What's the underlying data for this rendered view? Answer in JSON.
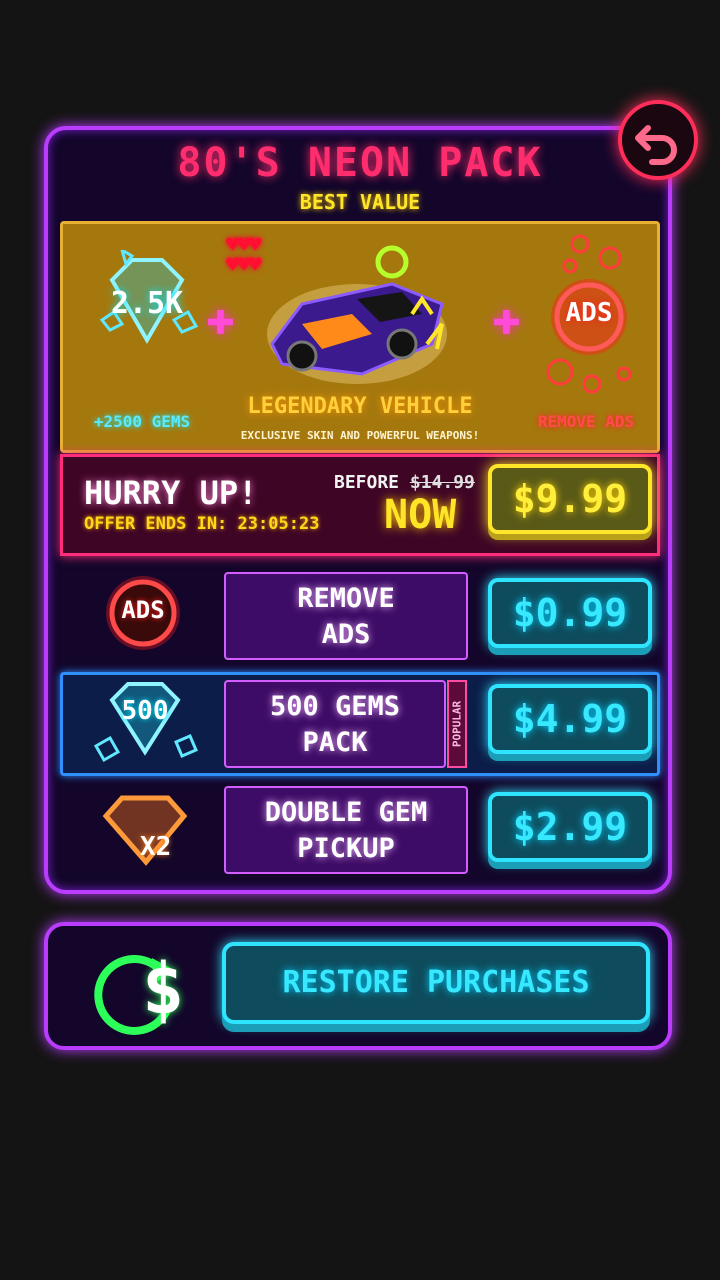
{
  "pack": {
    "title": "80'S NEON PACK",
    "subtitle": "BEST VALUE",
    "gem_icon_value": "2.5K",
    "gems_label": "+2500 GEMS",
    "vehicle_label": "LEGENDARY VEHICLE",
    "vehicle_desc": "EXCLUSIVE SKIN AND POWERFUL WEAPONS!",
    "ads_icon_text": "ADS",
    "remove_ads_label": "REMOVE ADS"
  },
  "offer": {
    "hurry": "HURRY UP!",
    "ends_label": "OFFER ENDS IN:",
    "timer": "23:05:23",
    "before_label": "BEFORE",
    "old_price": "$14.99",
    "now_label": "NOW",
    "price": "$9.99"
  },
  "items": [
    {
      "icon_text": "ADS",
      "line1": "REMOVE",
      "line2": "ADS",
      "price": "$0.99"
    },
    {
      "icon_text": "500",
      "line1": "500 GEMS",
      "line2": "PACK",
      "price": "$4.99",
      "badge": "POPULAR"
    },
    {
      "icon_text": "X2",
      "line1": "DOUBLE GEM",
      "line2": "PICKUP",
      "price": "$2.99"
    }
  ],
  "restore": {
    "icon_text": "$",
    "label": "RESTORE PURCHASES"
  },
  "icons": {
    "back": "undo-arrow-icon",
    "hearts": "heart-icon"
  },
  "colors": {
    "panel_border": "#b93cff",
    "title": "#ff2d6e",
    "best_value": "#ffe628",
    "cyan_button": "#2fe4ff",
    "yellow_button": "#ffe628"
  }
}
